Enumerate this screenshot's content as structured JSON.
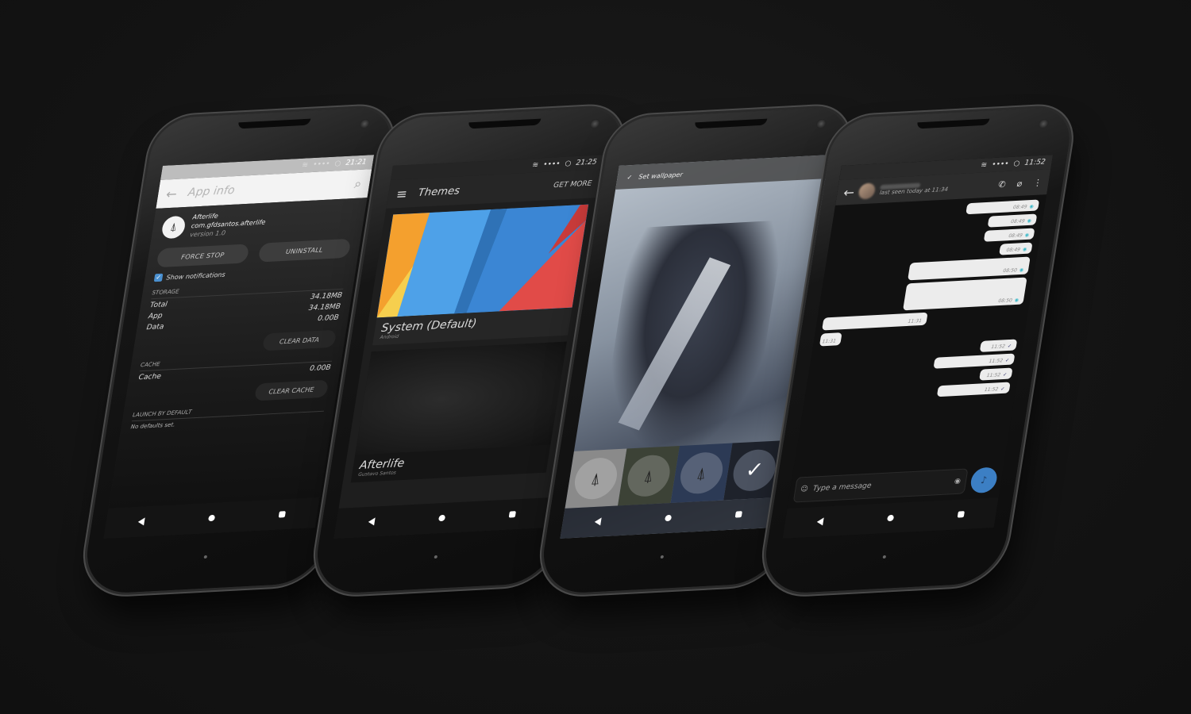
{
  "phones": {
    "app_info": {
      "status_time": "21:21",
      "title": "App info",
      "app_name": "Afterlife",
      "package": "com.gfdsantos.afterlife",
      "version": "version 1.0",
      "force_stop": "FORCE STOP",
      "uninstall": "UNINSTALL",
      "show_notifications": "Show notifications",
      "storage_header": "STORAGE",
      "storage": [
        {
          "label": "Total",
          "value": "34.18MB"
        },
        {
          "label": "App",
          "value": "34.18MB"
        },
        {
          "label": "Data",
          "value": "0.00B"
        }
      ],
      "clear_data": "CLEAR DATA",
      "cache_header": "CACHE",
      "cache": {
        "label": "Cache",
        "value": "0.00B"
      },
      "clear_cache": "CLEAR CACHE",
      "launch_header": "LAUNCH BY DEFAULT",
      "no_defaults": "No defaults set."
    },
    "themes": {
      "status_time": "21:25",
      "title": "Themes",
      "get_more": "GET MORE",
      "items": [
        {
          "name": "System (Default)",
          "author": "Android"
        },
        {
          "name": "Afterlife",
          "author": "Gustavo Santos"
        }
      ]
    },
    "wallpaper": {
      "action": "Set wallpaper",
      "thumbnails": 4,
      "selected_index": 3
    },
    "chat": {
      "status_time": "11:52",
      "last_seen": "last seen today at 11:34",
      "input_placeholder": "Type a message",
      "messages": [
        {
          "dir": "out",
          "time": "08:49",
          "status": "seen"
        },
        {
          "dir": "out",
          "time": "08:49",
          "status": "seen"
        },
        {
          "dir": "out",
          "time": "08:49",
          "status": "seen"
        },
        {
          "dir": "out",
          "time": "08:49",
          "status": "seen"
        },
        {
          "dir": "out",
          "time": "08:50",
          "status": "seen"
        },
        {
          "dir": "out",
          "time": "08:50",
          "status": "seen"
        },
        {
          "dir": "in",
          "time": "11:31",
          "status": ""
        },
        {
          "dir": "in",
          "time": "11:31",
          "status": ""
        },
        {
          "dir": "out",
          "time": "11:52",
          "status": "sent"
        },
        {
          "dir": "out",
          "time": "11:52",
          "status": "sent"
        },
        {
          "dir": "out",
          "time": "11:52",
          "status": "sent"
        },
        {
          "dir": "out",
          "time": "11:52",
          "status": "sent"
        }
      ]
    }
  },
  "icons": {
    "back": "←",
    "search": "⌕",
    "menu": "≡",
    "check": "✓",
    "phone": "✆",
    "attach": "⌀",
    "more": "⋮",
    "emoji": "☺",
    "camera": "◉",
    "mic": "♪",
    "wifi": "≋",
    "signal": "••••",
    "battery": "○",
    "eye": "◉",
    "app_glyph": "⍋"
  },
  "colors": {
    "accent_blue": "#3c7fc4",
    "seen_teal": "#3db9c9",
    "checkbox_blue": "#4a90d0"
  }
}
